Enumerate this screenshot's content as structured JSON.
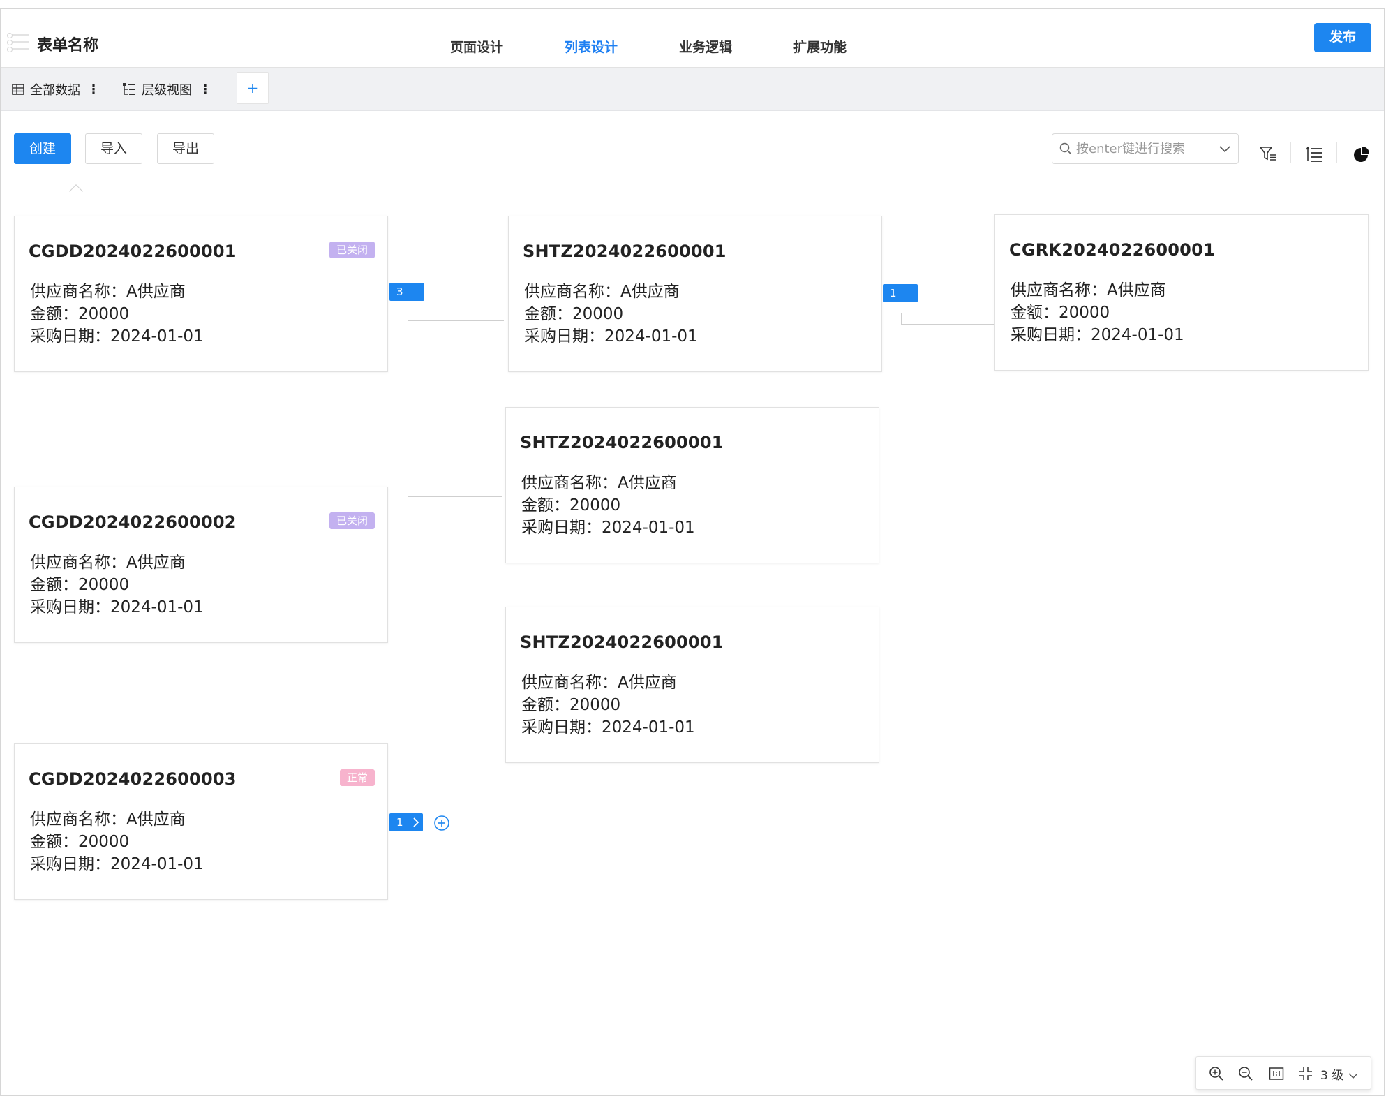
{
  "header": {
    "title": "表单名称",
    "tabs": [
      {
        "label": "页面设计",
        "active": false
      },
      {
        "label": "列表设计",
        "active": true
      },
      {
        "label": "业务逻辑",
        "active": false
      },
      {
        "label": "扩展功能",
        "active": false
      }
    ],
    "publish_label": "发布"
  },
  "views": {
    "all_data": "全部数据",
    "hierarchy": "层级视图",
    "add": "+"
  },
  "toolbar": {
    "create": "创建",
    "import": "导入",
    "export": "导出",
    "search_placeholder": "按enter键进行搜索"
  },
  "cards": [
    {
      "code": "CGDD2024022600001",
      "badge": "已关闭",
      "badge_color": "#c3b1f0",
      "supplier": "供应商名称：A供应商",
      "amount": "金额：20000",
      "date": "采购日期：2024-01-01"
    },
    {
      "code": "CGDD2024022600002",
      "badge": "已关闭",
      "badge_color": "#c3b1f0",
      "supplier": "供应商名称：A供应商",
      "amount": "金额：20000",
      "date": "采购日期：2024-01-01"
    },
    {
      "code": "CGDD2024022600003",
      "badge": "正常",
      "badge_color": "#f7b3cd",
      "supplier": "供应商名称：A供应商",
      "amount": "金额：20000",
      "date": "采购日期：2024-01-01"
    },
    {
      "code": "SHTZ2024022600001",
      "badge": "",
      "badge_color": "",
      "supplier": "供应商名称：A供应商",
      "amount": "金额：20000",
      "date": "采购日期：2024-01-01"
    },
    {
      "code": "SHTZ2024022600001",
      "badge": "",
      "badge_color": "",
      "supplier": "供应商名称：A供应商",
      "amount": "金额：20000",
      "date": "采购日期：2024-01-01"
    },
    {
      "code": "SHTZ2024022600001",
      "badge": "",
      "badge_color": "",
      "supplier": "供应商名称：A供应商",
      "amount": "金额：20000",
      "date": "采购日期：2024-01-01"
    },
    {
      "code": "CGRK2024022600001",
      "badge": "",
      "badge_color": "",
      "supplier": "供应商名称：A供应商",
      "amount": "金额：20000",
      "date": "采购日期：2024-01-01"
    }
  ],
  "counters": {
    "card1_children": "3",
    "shtz1_children": "1",
    "card3_children": "1"
  },
  "zoom": {
    "level": "3 级"
  },
  "colors": {
    "accent": "#1d86f0",
    "badge_closed": "#c3b1f0",
    "badge_normal": "#f7b3cd"
  }
}
